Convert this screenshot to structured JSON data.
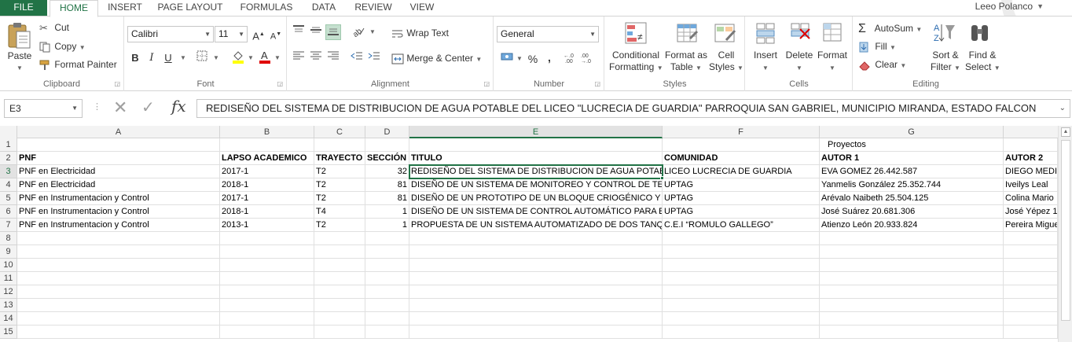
{
  "tabs": {
    "file": "FILE",
    "items": [
      "HOME",
      "INSERT",
      "PAGE LAYOUT",
      "FORMULAS",
      "DATA",
      "REVIEW",
      "VIEW"
    ],
    "active": "HOME"
  },
  "user": {
    "name": "Leeo Polanco"
  },
  "ribbon": {
    "clipboard": {
      "label": "Clipboard",
      "paste": "Paste",
      "cut": "Cut",
      "copy": "Copy",
      "format_painter": "Format Painter"
    },
    "font": {
      "label": "Font",
      "font_name": "Calibri",
      "font_size": "11",
      "bold": "B",
      "italic": "I",
      "underline": "U"
    },
    "alignment": {
      "label": "Alignment",
      "wrap_text": "Wrap Text",
      "merge_center": "Merge & Center"
    },
    "number": {
      "label": "Number",
      "format": "General",
      "percent": "%",
      "comma": ","
    },
    "styles": {
      "label": "Styles",
      "conditional_1": "Conditional",
      "conditional_2": "Formatting",
      "format_table_1": "Format as",
      "format_table_2": "Table",
      "cell_styles_1": "Cell",
      "cell_styles_2": "Styles"
    },
    "cells": {
      "label": "Cells",
      "insert": "Insert",
      "delete": "Delete",
      "format": "Format"
    },
    "editing": {
      "label": "Editing",
      "autosum": "AutoSum",
      "fill": "Fill",
      "clear": "Clear",
      "sort_1": "Sort &",
      "sort_2": "Filter",
      "find_1": "Find &",
      "find_2": "Select"
    }
  },
  "formula_bar": {
    "name_box": "E3",
    "content": "REDISEÑO DEL SISTEMA DE DISTRIBUCION DE AGUA POTABLE DEL LICEO \"LUCRECIA DE GUARDIA\" PARROQUIA SAN GABRIEL, MUNICIPIO MIRANDA, ESTADO FALCON"
  },
  "sheet": {
    "columns": [
      "A",
      "B",
      "C",
      "D",
      "E",
      "F",
      "G"
    ],
    "rows": [
      "1",
      "2",
      "3",
      "4",
      "5",
      "6",
      "7",
      "8",
      "9",
      "10",
      "11",
      "12",
      "13",
      "14",
      "15"
    ],
    "row1_merged_header": "Proyectos",
    "header_row": [
      "PNF",
      "LAPSO ACADEMICO",
      "TRAYECTO",
      "SECCIÓN",
      "TITULO",
      "COMUNIDAD",
      "AUTOR  1",
      "AUTOR  2"
    ],
    "data_rows": [
      [
        "PNF en Electricidad",
        "2017-1",
        "T2",
        "32",
        "REDISEÑO DEL SISTEMA DE DISTRIBUCION DE AGUA POTABLE DEL LICEO",
        "LICEO LUCRECIA DE GUARDIA",
        "EVA GOMEZ 26.442.587",
        "DIEGO MEDINA"
      ],
      [
        "PNF en Electricidad",
        "2018-1",
        "T2",
        "81",
        "DISEÑO DE UN SISTEMA DE MONITOREO Y CONTROL DE TEMPERATURA",
        "UPTAG",
        "Yanmelis González  25.352.744",
        "Iveilys Leal"
      ],
      [
        "PNF en Instrumentacion y Control",
        "2017-1",
        "T2",
        "81",
        "DISEÑO DE UN PROTOTIPO DE UN BLOQUE CRIOGÉNICO Y DE TEMPERATURA",
        "UPTAG",
        "Arévalo Naibeth  25.504.125",
        "Colina Mario"
      ],
      [
        "PNF en Instrumentacion y Control",
        "2018-1",
        "T4",
        "1",
        "DISEÑO DE UN SISTEMA DE CONTROL AUTOMÁTICO PARA EL CONTROL",
        "UPTAG",
        "José Suárez 20.681.306",
        "José Yépez 1"
      ],
      [
        "PNF en Instrumentacion y Control",
        "2013-1",
        "T2",
        "1",
        "PROPUESTA DE UN SISTEMA AUTOMATIZADO DE DOS TANQUES",
        "C.E.I “ROMULO GALLEGO”",
        "Atienzo León  20.933.824",
        "Pereira Miguel"
      ]
    ],
    "active_cell": "E3",
    "selected_column": "E",
    "selected_row": "3"
  },
  "colors": {
    "accent": "#217346"
  }
}
